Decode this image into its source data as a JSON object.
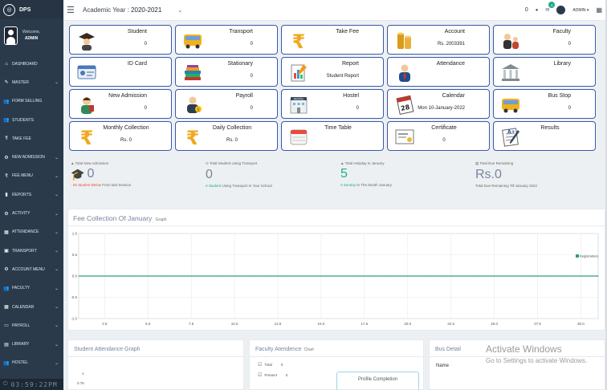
{
  "app": {
    "name": "DPS"
  },
  "profile": {
    "welcome": "Welcome,",
    "name": "ADMIN"
  },
  "sidebar": {
    "items": [
      {
        "label": "DASHBOARD",
        "icon": "home-icon",
        "chev": false
      },
      {
        "label": "Master",
        "icon": "edit-icon",
        "chev": true
      },
      {
        "label": "FORM SELLING",
        "icon": "users-icon",
        "chev": false
      },
      {
        "label": "STUDENTS",
        "icon": "users-icon",
        "chev": false
      },
      {
        "label": "TAKE FEE",
        "icon": "rupee-icon",
        "chev": false
      },
      {
        "label": "NEW ADMISSION",
        "icon": "gear-icon",
        "chev": true
      },
      {
        "label": "FEE MENU",
        "icon": "rupee-icon",
        "chev": true
      },
      {
        "label": "REPORTS",
        "icon": "bar-chart-icon",
        "chev": true
      },
      {
        "label": "ACTIVITY",
        "icon": "gear-icon",
        "chev": true
      },
      {
        "label": "ATTENDANCE",
        "icon": "calendar-icon",
        "chev": true
      },
      {
        "label": "TRANSPORT",
        "icon": "bus-icon",
        "chev": true
      },
      {
        "label": "ACCOUNT MENU",
        "icon": "gear-icon",
        "chev": true
      },
      {
        "label": "FACULTY",
        "icon": "users-icon",
        "chev": true
      },
      {
        "label": "CALENDAR",
        "icon": "calendar-icon",
        "chev": true
      },
      {
        "label": "PAYROLL",
        "icon": "folder-icon",
        "chev": true
      },
      {
        "label": "LIBRARY",
        "icon": "book-icon",
        "chev": true
      },
      {
        "label": "HOSTEL",
        "icon": "users-icon",
        "chev": true
      }
    ]
  },
  "clock": {
    "time": "03:59:22PM"
  },
  "topbar": {
    "year_label": "Academic Year :",
    "year_value": "2020-2021",
    "notif_count": "0",
    "mail_badge": "6",
    "user": "ADMIN"
  },
  "tiles": [
    {
      "label": "Student",
      "sub": "0",
      "icon": "graduate-icon",
      "align": "r"
    },
    {
      "label": "Transport",
      "sub": "0",
      "icon": "bus-icon",
      "align": "r"
    },
    {
      "label": "Take Fee",
      "sub": "",
      "icon": "rupee-icon",
      "align": "r"
    },
    {
      "label": "Account",
      "sub": "Rs. 2003391",
      "icon": "coins-icon",
      "align": "r"
    },
    {
      "label": "Faculty",
      "sub": "0",
      "icon": "teacher-icon",
      "align": "r"
    },
    {
      "label": "ID Card",
      "sub": "",
      "icon": "id-card-icon",
      "align": "r"
    },
    {
      "label": "Stationary",
      "sub": "0",
      "icon": "books-icon",
      "align": "r"
    },
    {
      "label": "Report",
      "sub": "Student Report",
      "icon": "report-icon",
      "align": "r"
    },
    {
      "label": "Attendance",
      "sub": "",
      "icon": "person-icon",
      "align": "r"
    },
    {
      "label": "Library",
      "sub": "",
      "icon": "library-icon",
      "align": "r"
    },
    {
      "label": "New Admission",
      "sub": "0",
      "icon": "student-icon",
      "align": "r"
    },
    {
      "label": "Payroll",
      "sub": "0",
      "icon": "payroll-icon",
      "align": "r"
    },
    {
      "label": "Hostel",
      "sub": "0",
      "icon": "hostel-icon",
      "align": "r"
    },
    {
      "label": "Calendar",
      "sub": "Mon 10-January-2022",
      "icon": "calendar-icon",
      "align": "r"
    },
    {
      "label": "Bus Stop",
      "sub": "0",
      "icon": "bus-icon",
      "align": "r"
    },
    {
      "label": "Monthly Collection",
      "sub": "Rs. 0",
      "icon": "rupee-icon",
      "align": "c"
    },
    {
      "label": "Daily Collection",
      "sub": "Rs. 0",
      "icon": "rupee-icon",
      "align": "c"
    },
    {
      "label": "Time Table",
      "sub": "",
      "icon": "timetable-icon",
      "align": "c"
    },
    {
      "label": "Certificate",
      "sub": "0",
      "icon": "certificate-icon",
      "align": "c"
    },
    {
      "label": "Results",
      "sub": "",
      "icon": "results-icon",
      "align": "c"
    }
  ],
  "stats": [
    {
      "title": "Total New Admission",
      "value": "0",
      "foot_em": "- 55 Student Below",
      "foot": "From last Session",
      "em_class": "red",
      "green": false
    },
    {
      "title": "Total Student Using Transport",
      "value": "0",
      "foot_em": "0 Student",
      "foot": "Using Transport In Your School",
      "em_class": "green",
      "green": false
    },
    {
      "title": "Total Holyday in January",
      "value": "5",
      "foot_em": "5 Sunday",
      "foot": "In The Month January",
      "em_class": "green",
      "green": true
    },
    {
      "title": "Total Due Remaining",
      "value": "Rs.0",
      "foot_em": "",
      "foot": "Total Due Remaining Till January 2022",
      "em_class": "",
      "green": false
    }
  ],
  "fee_graph": {
    "title": "Fee Collection Of January",
    "subtitle": "Graph"
  },
  "chart_data": {
    "type": "line",
    "title": "Fee Collection Of January",
    "x": [
      1,
      2,
      3,
      4,
      5,
      6,
      7,
      8,
      9,
      10,
      11,
      12,
      13,
      14,
      15,
      16,
      17,
      18,
      19,
      20,
      21,
      22,
      23,
      24,
      25,
      26,
      27,
      28,
      29,
      30,
      31
    ],
    "series": [
      {
        "name": "Registrations",
        "values": [
          0,
          0,
          0,
          0,
          0,
          0,
          0,
          0,
          0,
          0,
          0,
          0,
          0,
          0,
          0,
          0,
          0,
          0,
          0,
          0,
          0,
          0,
          0,
          0,
          0,
          0,
          0,
          0,
          0,
          0,
          0
        ],
        "color": "#26a37e"
      }
    ],
    "xticks": [
      "2.5",
      "5.0",
      "7.5",
      "10.0",
      "12.5",
      "15.0",
      "17.5",
      "20.0",
      "22.5",
      "25.0",
      "27.5",
      "30.0"
    ],
    "yticks": [
      "1.0",
      "0.5",
      "0.0",
      "-0.5",
      "-1.0"
    ],
    "xlim": [
      1,
      31
    ],
    "ylim": [
      -1,
      1
    ],
    "grid": true,
    "legend": "top-right"
  },
  "attendance": {
    "title": "Student Attendance Graph",
    "yticks": [
      "1",
      "0.75"
    ]
  },
  "faculty": {
    "title": "Faculty Atendence",
    "subtitle": "Chart",
    "rows": [
      {
        "label": "Total",
        "value": "0"
      },
      {
        "label": "Present",
        "value": "0"
      }
    ],
    "profile_box": "Profile Completion"
  },
  "bus": {
    "title": "Bus Detail",
    "name_label": "Name"
  },
  "watermark": {
    "line1": "Activate Windows",
    "line2": "Go to Settings to activate Windows."
  }
}
